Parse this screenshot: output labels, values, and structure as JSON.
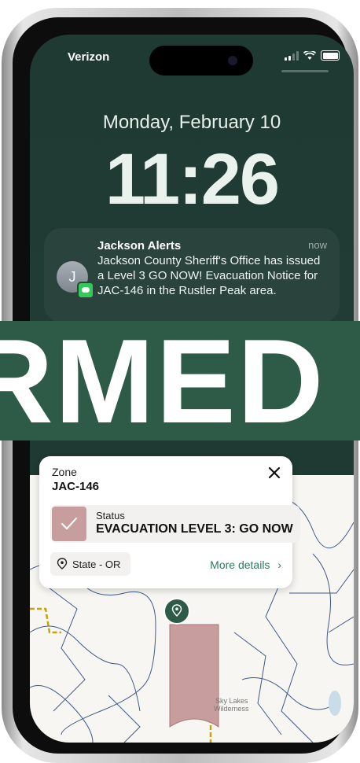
{
  "status_bar": {
    "carrier": "Verizon",
    "icons": [
      "signal-icon",
      "wifi-icon",
      "battery-icon"
    ]
  },
  "lock_screen": {
    "date": "Monday, February 10",
    "time": "11:26"
  },
  "notification": {
    "sender": "Jackson Alerts",
    "when": "now",
    "avatar_initial": "J",
    "message": "Jackson County Sheriff's Office has issued a Level 3 GO NOW! Evacuation Notice for JAC-146 in the Rustler Peak area."
  },
  "banner": {
    "text": "RMED"
  },
  "zone_card": {
    "zone_label": "Zone",
    "zone_name": "JAC-146",
    "status_label": "Status",
    "status_value": "EVACUATION LEVEL 3: GO NOW",
    "chip_label": "State - OR",
    "more_link": "More details",
    "status_color": "#c89d9d"
  },
  "map": {
    "place_label": "Sky Lakes Wilderness"
  },
  "colors": {
    "brand_green": "#2e5a48",
    "link_green": "#2e7a5e",
    "zone_fill": "#c89d9d"
  }
}
